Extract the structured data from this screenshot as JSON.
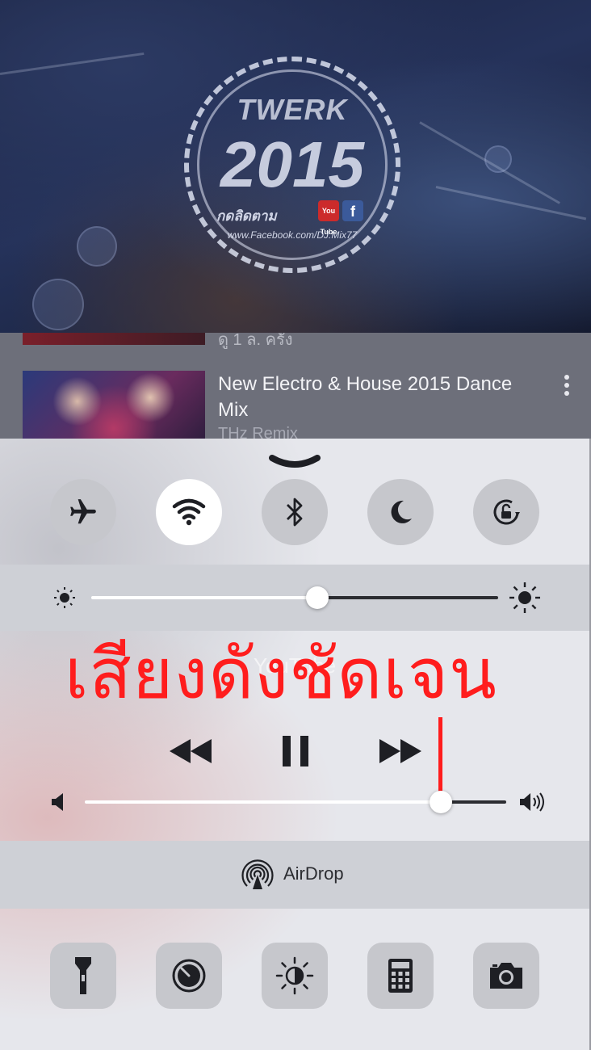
{
  "video": {
    "logo_title": "TWERK",
    "logo_year": "2015",
    "logo_brand": "กดลิดตาม",
    "logo_youtube_badge": "You Tube",
    "logo_facebook_badge": "f",
    "logo_url": "www.Facebook.com/DJ.Mix77"
  },
  "list": {
    "items": [
      {
        "meta": "ดู 1 ล. ครั้ง"
      },
      {
        "title": "New Electro & House 2015 Dance Mix",
        "channel": "THz Remix"
      }
    ]
  },
  "control_center": {
    "toggles": [
      {
        "name": "airplane-mode",
        "icon": "airplane-icon",
        "state": "off"
      },
      {
        "name": "wifi",
        "icon": "wifi-icon",
        "state": "on"
      },
      {
        "name": "bluetooth",
        "icon": "bluetooth-icon",
        "state": "off"
      },
      {
        "name": "do-not-disturb",
        "icon": "moon-icon",
        "state": "off"
      },
      {
        "name": "rotation-lock",
        "icon": "rotation-lock-icon",
        "state": "off"
      }
    ],
    "brightness": {
      "level": 0.555
    },
    "now_playing": "YouTube",
    "volume": {
      "level": 0.845
    },
    "overlay_caption": "เสียงดังชัดเจน",
    "airdrop_label": "AirDrop",
    "tools": [
      {
        "name": "flashlight",
        "icon": "flashlight-icon"
      },
      {
        "name": "timer",
        "icon": "timer-icon"
      },
      {
        "name": "night-shift",
        "icon": "night-shift-icon"
      },
      {
        "name": "calculator",
        "icon": "calculator-icon"
      },
      {
        "name": "camera",
        "icon": "camera-icon"
      }
    ],
    "colors": {
      "caption": "#ff1d1d",
      "panel": "#e6e7ec",
      "toggle_off": "#c6c7cc",
      "toggle_on": "#ffffff"
    }
  }
}
